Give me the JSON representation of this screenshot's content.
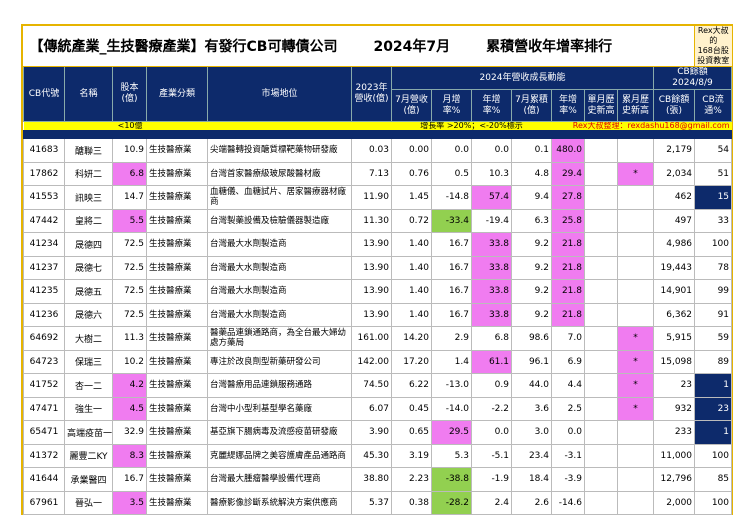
{
  "title": {
    "part1": "【傳統產業_生技醫療產業】有發行CB可轉債公司",
    "part2": "2024年7月",
    "part3": "累積營收年增率排行",
    "rex_line1": "Rex大叔的",
    "rex_line2": "168台股投資教室"
  },
  "headers": {
    "code": "CB代號",
    "name": "名稱",
    "capital": "股本(億)",
    "industry": "產業分類",
    "market": "市場地位",
    "rev2023": "2023年營收(億)",
    "group2024": "2024年營收成長動能",
    "cb_group": "CB餘額 2024/8/9",
    "jul_rev": "7月營收(億)",
    "mom": "月增率%",
    "yoy": "年增率%",
    "jul_cum": "7月累積(億)",
    "cum_yoy": "年增率%",
    "single_high": "單月歷史新高",
    "cum_high": "累月歷史新高",
    "cb_balance": "CB餘額(張)",
    "cb_float": "CB流通%"
  },
  "legend": {
    "capital_note": "<10億",
    "growth_note": "增長率 >20%；<-20%標示",
    "author": "Rex大叔整理：rexdashu168@gmail.com"
  },
  "colors": {
    "pink": "#f07cf0",
    "green": "#92d050",
    "navy": "#0d2a6b",
    "gold": "#e6b400"
  },
  "rows": [
    {
      "code": "41683",
      "name": "醣聯三",
      "capital": "10.9",
      "industry": "生技醫療業",
      "market": "尖端醫轉投資醣質標靶藥物研發廠",
      "rev2023": "0.03",
      "jul_rev": "0.00",
      "mom": "0.0",
      "yoy": "0.0",
      "jul_cum": "0.1",
      "cum_yoy": "480.0",
      "single_high": "",
      "cum_high": "",
      "cb_balance": "2,179",
      "cb_float": "54",
      "hl": {
        "cum_yoy": "pink"
      }
    },
    {
      "code": "17862",
      "name": "科妍二",
      "capital": "6.8",
      "industry": "生技醫療業",
      "market": "台灣首家醫療級玻尿酸醫材廠",
      "rev2023": "7.13",
      "jul_rev": "0.76",
      "mom": "0.5",
      "yoy": "10.3",
      "jul_cum": "4.8",
      "cum_yoy": "29.4",
      "single_high": "",
      "cum_high": "*",
      "cb_balance": "2,034",
      "cb_float": "51",
      "hl": {
        "capital": "pink",
        "cum_yoy": "pink",
        "cum_high": "pink"
      }
    },
    {
      "code": "41553",
      "name": "訊映三",
      "capital": "14.7",
      "industry": "生技醫療業",
      "market": "血糖儀、血糖試片、居家醫療器材廠商",
      "rev2023": "11.90",
      "jul_rev": "1.45",
      "mom": "-14.8",
      "yoy": "57.4",
      "jul_cum": "9.4",
      "cum_yoy": "27.8",
      "single_high": "",
      "cum_high": "",
      "cb_balance": "462",
      "cb_float": "15",
      "hl": {
        "yoy": "pink",
        "cum_yoy": "pink",
        "cb_float": "navy"
      }
    },
    {
      "code": "47442",
      "name": "皇將二",
      "capital": "5.5",
      "industry": "生技醫療業",
      "market": "台灣製藥設備及檢驗儀器製造廠",
      "rev2023": "11.30",
      "jul_rev": "0.72",
      "mom": "-33.4",
      "yoy": "-19.4",
      "jul_cum": "6.3",
      "cum_yoy": "25.8",
      "single_high": "",
      "cum_high": "",
      "cb_balance": "497",
      "cb_float": "33",
      "hl": {
        "capital": "pink",
        "mom": "green",
        "cum_yoy": "pink"
      }
    },
    {
      "code": "41234",
      "name": "晟德四",
      "capital": "72.5",
      "industry": "生技醫療業",
      "market": "台灣最大水劑製造商",
      "rev2023": "13.90",
      "jul_rev": "1.40",
      "mom": "16.7",
      "yoy": "33.8",
      "jul_cum": "9.2",
      "cum_yoy": "21.8",
      "single_high": "",
      "cum_high": "",
      "cb_balance": "4,986",
      "cb_float": "100",
      "hl": {
        "yoy": "pink",
        "cum_yoy": "pink"
      }
    },
    {
      "code": "41237",
      "name": "晟德七",
      "capital": "72.5",
      "industry": "生技醫療業",
      "market": "台灣最大水劑製造商",
      "rev2023": "13.90",
      "jul_rev": "1.40",
      "mom": "16.7",
      "yoy": "33.8",
      "jul_cum": "9.2",
      "cum_yoy": "21.8",
      "single_high": "",
      "cum_high": "",
      "cb_balance": "19,443",
      "cb_float": "78",
      "hl": {
        "yoy": "pink",
        "cum_yoy": "pink"
      }
    },
    {
      "code": "41235",
      "name": "晟德五",
      "capital": "72.5",
      "industry": "生技醫療業",
      "market": "台灣最大水劑製造商",
      "rev2023": "13.90",
      "jul_rev": "1.40",
      "mom": "16.7",
      "yoy": "33.8",
      "jul_cum": "9.2",
      "cum_yoy": "21.8",
      "single_high": "",
      "cum_high": "",
      "cb_balance": "14,901",
      "cb_float": "99",
      "hl": {
        "yoy": "pink",
        "cum_yoy": "pink"
      }
    },
    {
      "code": "41236",
      "name": "晟德六",
      "capital": "72.5",
      "industry": "生技醫療業",
      "market": "台灣最大水劑製造商",
      "rev2023": "13.90",
      "jul_rev": "1.40",
      "mom": "16.7",
      "yoy": "33.8",
      "jul_cum": "9.2",
      "cum_yoy": "21.8",
      "single_high": "",
      "cum_high": "",
      "cb_balance": "6,362",
      "cb_float": "91",
      "hl": {
        "yoy": "pink",
        "cum_yoy": "pink"
      }
    },
    {
      "code": "64692",
      "name": "大樹二",
      "capital": "11.3",
      "industry": "生技醫療業",
      "market": "醫藥品連鎖通路商，為全台最大婦幼處方藥局",
      "rev2023": "161.00",
      "jul_rev": "14.20",
      "mom": "2.9",
      "yoy": "6.8",
      "jul_cum": "98.6",
      "cum_yoy": "7.0",
      "single_high": "",
      "cum_high": "*",
      "cb_balance": "5,915",
      "cb_float": "59",
      "hl": {
        "cum_high": "pink"
      }
    },
    {
      "code": "64723",
      "name": "保瑞三",
      "capital": "10.2",
      "industry": "生技醫療業",
      "market": "專注於改良劑型新藥研發公司",
      "rev2023": "142.00",
      "jul_rev": "17.20",
      "mom": "1.4",
      "yoy": "61.1",
      "jul_cum": "96.1",
      "cum_yoy": "6.9",
      "single_high": "",
      "cum_high": "*",
      "cb_balance": "15,098",
      "cb_float": "89",
      "hl": {
        "yoy": "pink",
        "cum_high": "pink"
      }
    },
    {
      "code": "41752",
      "name": "杏一二",
      "capital": "4.2",
      "industry": "生技醫療業",
      "market": "台灣醫療用品連鎖服務通路",
      "rev2023": "74.50",
      "jul_rev": "6.22",
      "mom": "-13.0",
      "yoy": "0.9",
      "jul_cum": "44.0",
      "cum_yoy": "4.4",
      "single_high": "",
      "cum_high": "*",
      "cb_balance": "23",
      "cb_float": "1",
      "hl": {
        "capital": "pink",
        "cum_high": "pink",
        "cb_float": "navy"
      }
    },
    {
      "code": "47471",
      "name": "強生一",
      "capital": "4.5",
      "industry": "生技醫療業",
      "market": "台灣中小型利基型學名藥廠",
      "rev2023": "6.07",
      "jul_rev": "0.45",
      "mom": "-14.0",
      "yoy": "-2.2",
      "jul_cum": "3.6",
      "cum_yoy": "2.5",
      "single_high": "",
      "cum_high": "*",
      "cb_balance": "932",
      "cb_float": "23",
      "hl": {
        "capital": "pink",
        "cum_high": "pink",
        "cb_float": "navy"
      }
    },
    {
      "code": "65471",
      "name": "高端疫苗一",
      "capital": "32.9",
      "industry": "生技醫療業",
      "market": "基亞旗下腸病毒及流感疫苗研發廠",
      "rev2023": "3.90",
      "jul_rev": "0.65",
      "mom": "29.5",
      "yoy": "0.0",
      "jul_cum": "3.0",
      "cum_yoy": "0.0",
      "single_high": "",
      "cum_high": "",
      "cb_balance": "233",
      "cb_float": "1",
      "hl": {
        "mom": "pink",
        "cb_float": "navy"
      }
    },
    {
      "code": "41372",
      "name": "麗豐二KY",
      "capital": "8.3",
      "industry": "生技醫療業",
      "market": "克麗緹娜品牌之美容護膚產品通路商",
      "rev2023": "45.30",
      "jul_rev": "3.19",
      "mom": "5.3",
      "yoy": "-5.1",
      "jul_cum": "23.4",
      "cum_yoy": "-3.1",
      "single_high": "",
      "cum_high": "",
      "cb_balance": "11,000",
      "cb_float": "100",
      "hl": {
        "capital": "pink"
      }
    },
    {
      "code": "41644",
      "name": "承業醫四",
      "capital": "16.7",
      "industry": "生技醫療業",
      "market": "台灣最大腫瘤醫學設備代理商",
      "rev2023": "38.80",
      "jul_rev": "2.23",
      "mom": "-38.8",
      "yoy": "-1.9",
      "jul_cum": "18.4",
      "cum_yoy": "-3.9",
      "single_high": "",
      "cum_high": "",
      "cb_balance": "12,796",
      "cb_float": "85",
      "hl": {
        "mom": "green"
      }
    },
    {
      "code": "67961",
      "name": "晉弘一",
      "capital": "3.5",
      "industry": "生技醫療業",
      "market": "醫療影像診斷系統解決方案供應商",
      "rev2023": "5.37",
      "jul_rev": "0.38",
      "mom": "-28.2",
      "yoy": "2.4",
      "jul_cum": "2.6",
      "cum_yoy": "-14.6",
      "single_high": "",
      "cum_high": "",
      "cb_balance": "2,000",
      "cb_float": "100",
      "hl": {
        "capital": "pink",
        "mom": "green"
      }
    }
  ]
}
